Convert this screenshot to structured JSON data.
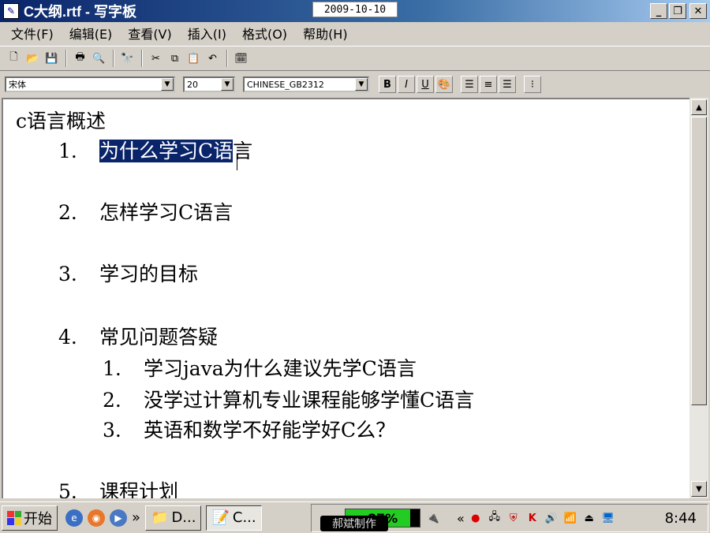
{
  "window": {
    "title": "C大纲.rtf - 写字板",
    "date_overlay": "2009-10-10",
    "minimize": "_",
    "restore": "❐",
    "close": "✕"
  },
  "menu": [
    "文件(F)",
    "编辑(E)",
    "查看(V)",
    "插入(I)",
    "格式(O)",
    "帮助(H)"
  ],
  "toolbar_icons": [
    "new-icon",
    "open-icon",
    "save-icon",
    "print-icon",
    "print-preview-icon",
    "find-icon",
    "cut-icon",
    "copy-icon",
    "paste-icon",
    "undo-icon",
    "datetime-icon"
  ],
  "format": {
    "font_name": "宋体",
    "font_size": "20",
    "script": "CHINESE_GB2312",
    "bold": "B",
    "italic": "I",
    "underline": "U"
  },
  "document": {
    "heading": "c语言概述",
    "items": [
      {
        "num": "1.",
        "selected": "为什么学习C语",
        "rest": "言"
      },
      {
        "num": "2.",
        "text": "怎样学习C语言"
      },
      {
        "num": "3.",
        "text": "学习的目标"
      },
      {
        "num": "4.",
        "text": "常见问题答疑"
      },
      {
        "num": "5.",
        "text": "课程计划"
      }
    ],
    "subitems": [
      {
        "num": "1.",
        "text": "学习java为什么建议先学C语言"
      },
      {
        "num": "2.",
        "text": "没学过计算机专业课程能够学懂C语言"
      },
      {
        "num": "3.",
        "text": "英语和数学不好能学好C么？"
      }
    ]
  },
  "taskbar": {
    "start_label": "开始",
    "more": "»",
    "task_1": "D...",
    "task_2": "C...",
    "battery_percent": 87,
    "battery_label": "87%",
    "watermark": "郝斌制作",
    "tray_more": "«",
    "clock": "8:44"
  }
}
